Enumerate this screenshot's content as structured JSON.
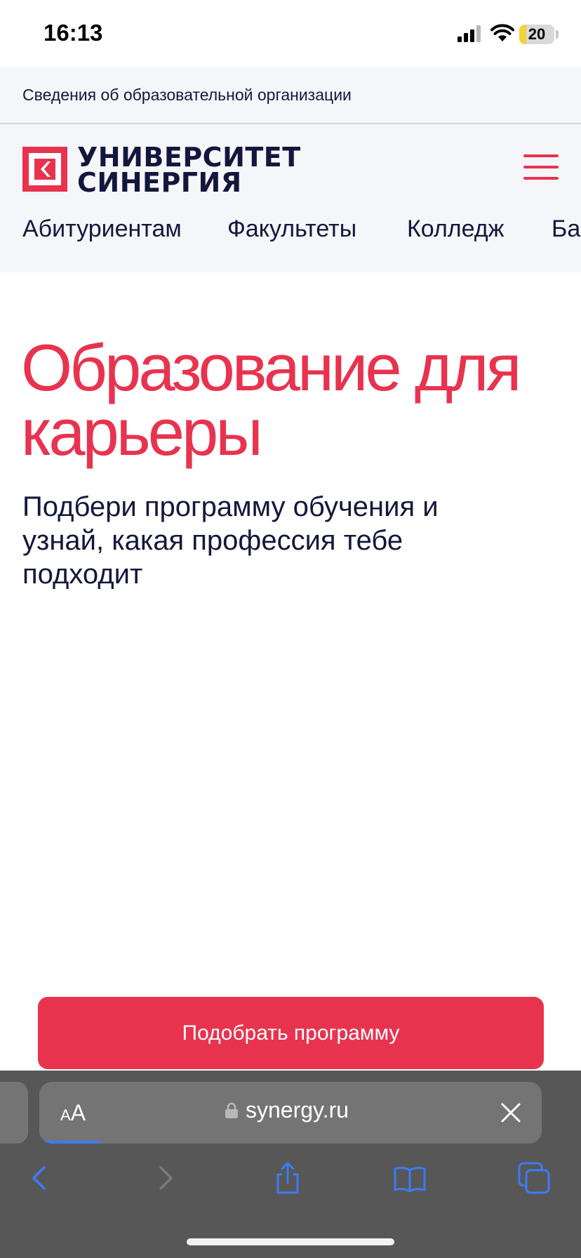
{
  "status_bar": {
    "time": "16:13",
    "battery_level": "20",
    "battery_fraction": 0.2,
    "icons": [
      "signal-icon",
      "wifi-icon",
      "battery-icon"
    ]
  },
  "info_bar": {
    "link": "Сведения об образовательной организации"
  },
  "header": {
    "logo": {
      "line1": "УНИВЕРСИТЕТ",
      "line2": "СИНЕРГИЯ"
    },
    "menu_icon": "hamburger-menu-icon",
    "nav": [
      {
        "label": "Абитуриентам"
      },
      {
        "label": "Факультеты"
      },
      {
        "label": "Колледж"
      },
      {
        "label": "Ба"
      }
    ]
  },
  "hero": {
    "title": "Образование для карьеры",
    "subtitle": "Подбери программу обучения и узнай, какая профессия тебе подходит"
  },
  "cta": {
    "label": "Подобрать программу"
  },
  "browser": {
    "text_size_small": "A",
    "text_size_big": "A",
    "url": "synergy.ru",
    "load_progress": 0.12,
    "toolbar": [
      "back-icon",
      "forward-icon",
      "share-icon",
      "bookmarks-icon",
      "tabs-icon"
    ]
  },
  "colors": {
    "brand": "#e8334f",
    "text_dark": "#14173c",
    "header_bg": "#f5f6fa",
    "browser_chrome": "#575757",
    "browser_accent": "#3d7bf4"
  }
}
